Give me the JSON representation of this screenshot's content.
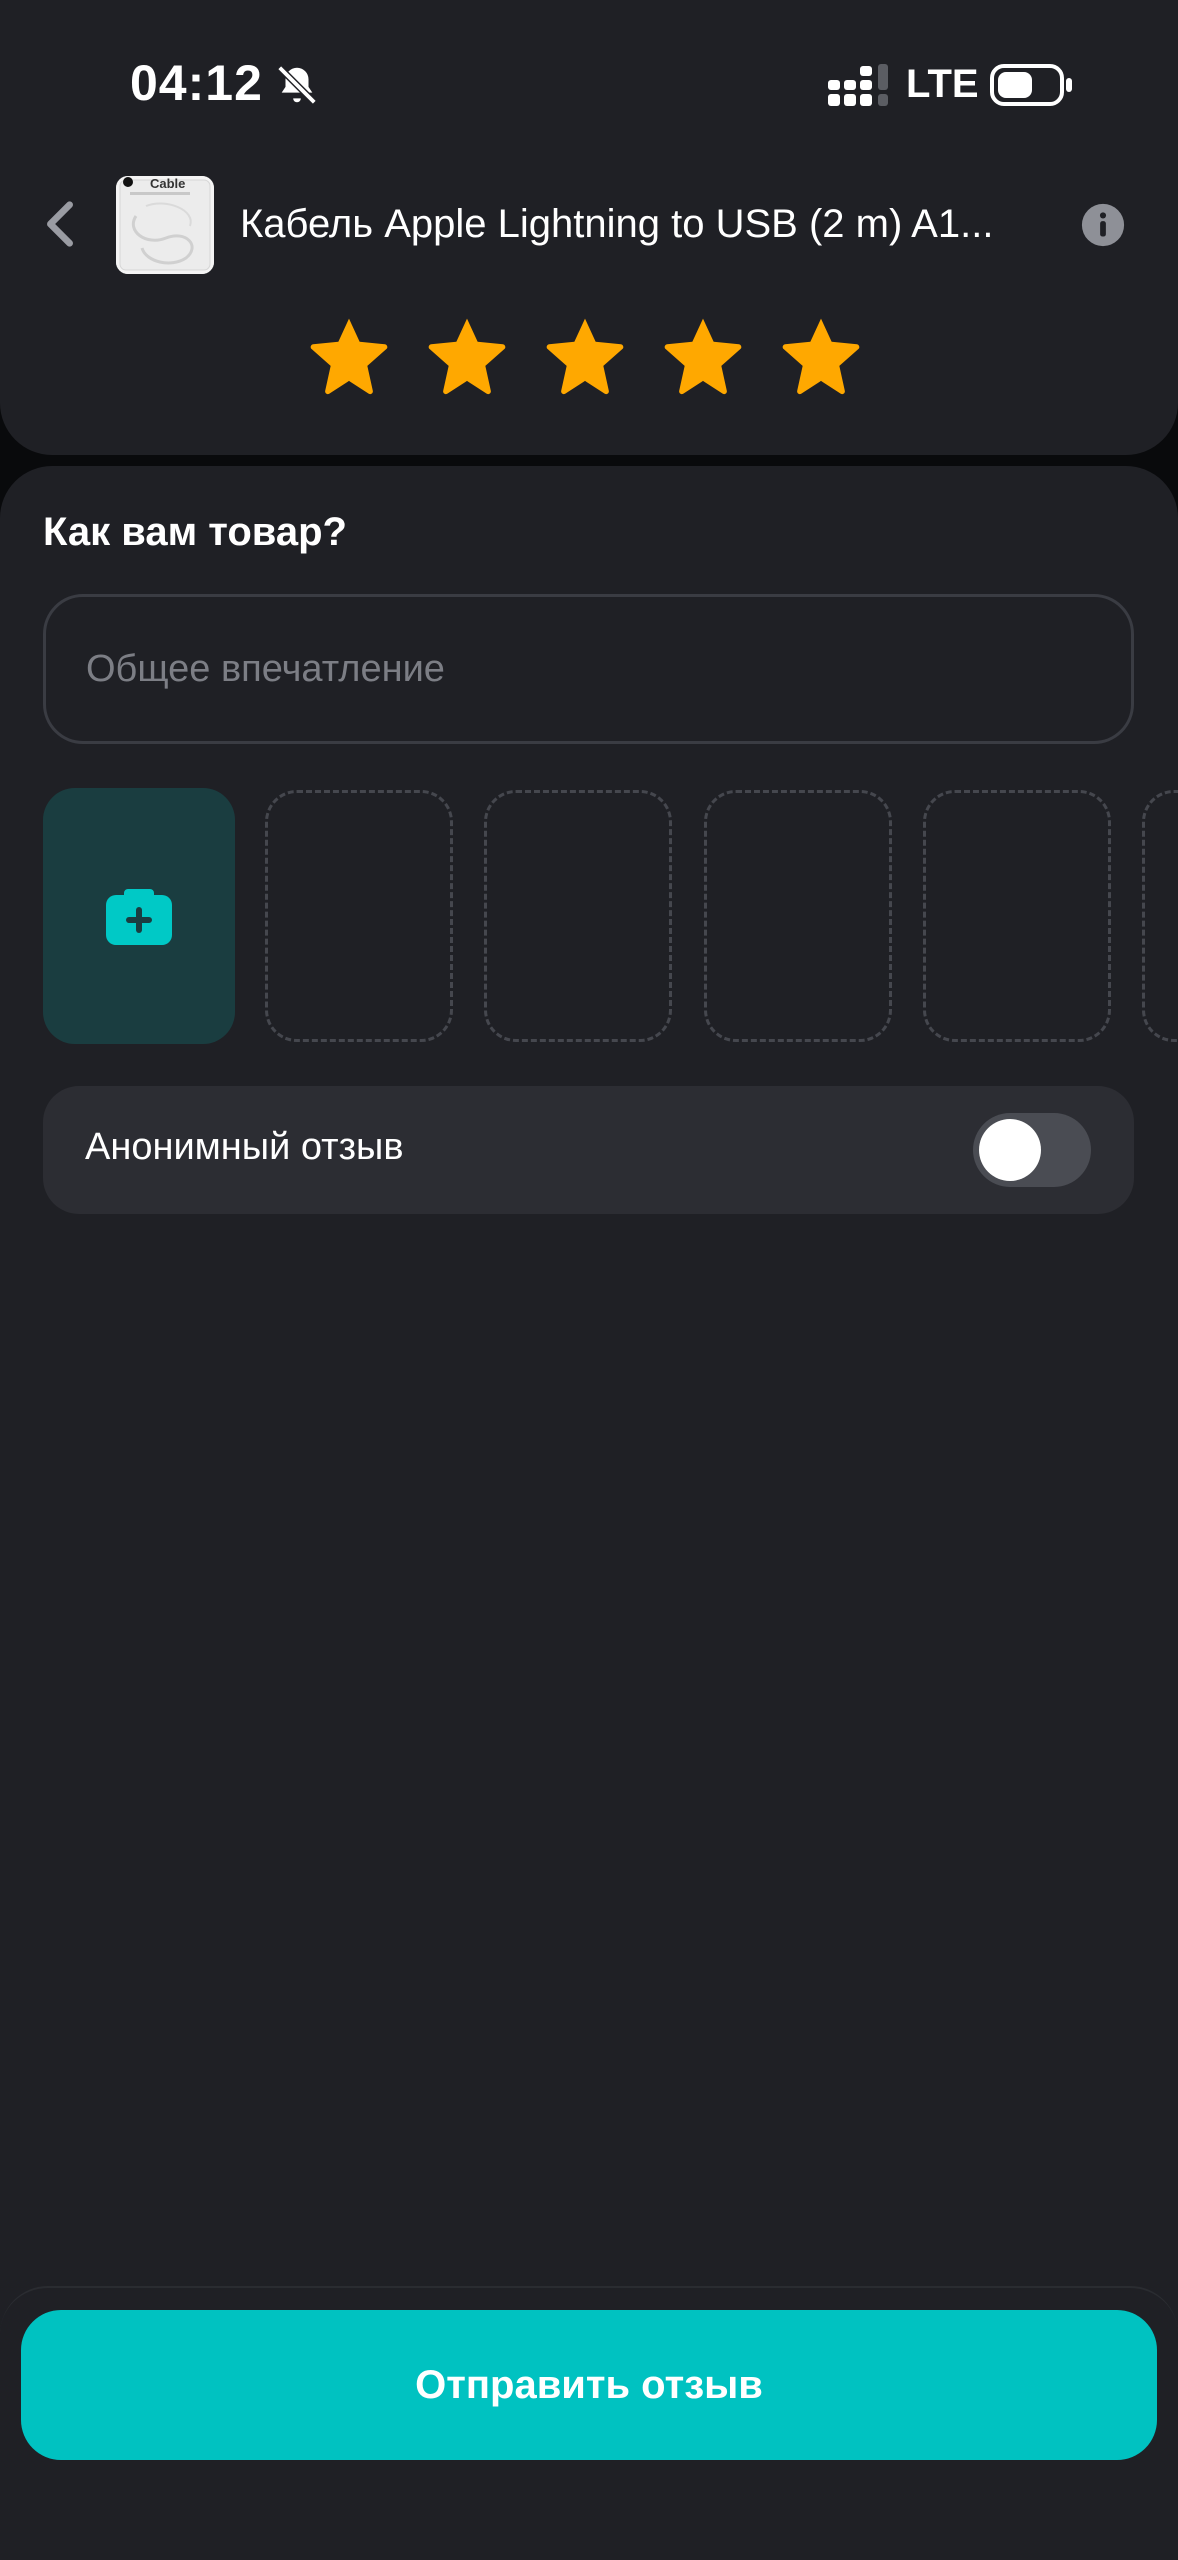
{
  "status_bar": {
    "time": "04:12",
    "network": "LTE",
    "icons": [
      "bell-muted-icon",
      "signal-icon",
      "battery-icon"
    ]
  },
  "header": {
    "back_icon": "chevron-left-icon",
    "product_title": "Кабель Apple Lightning to USB (2 m) A1...",
    "thumbnail_text": "Cable",
    "info_icon": "info-icon"
  },
  "rating": {
    "value": 5,
    "max": 5,
    "star_color": "#ffa800"
  },
  "review": {
    "section_title": "Как вам товар?",
    "impression_placeholder": "Общее впечатление",
    "impression_value": "",
    "add_photo_icon": "camera-plus-icon",
    "photo_slots": 5,
    "anonymous_label": "Анонимный отзыв",
    "anonymous_enabled": false
  },
  "actions": {
    "submit_label": "Отправить отзыв"
  },
  "colors": {
    "accent": "#00c2c1",
    "surface": "#1f2025",
    "background": "#090a0c",
    "star": "#ffa800"
  }
}
